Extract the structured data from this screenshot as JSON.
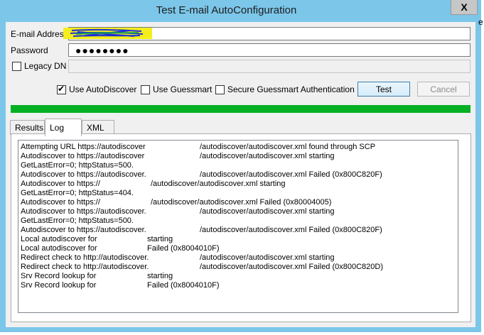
{
  "window": {
    "title": "Test E-mail AutoConfiguration",
    "close_glyph": "X",
    "side_char": "e"
  },
  "form": {
    "email_label": "E-mail Address",
    "password_label": "Password",
    "password_value": "●●●●●●●●",
    "legacy_dn_label": "Legacy DN"
  },
  "options": {
    "use_autodiscover": "Use AutoDiscover",
    "use_guessmart": "Use Guessmart",
    "secure_guessmart": "Secure Guessmart Authentication"
  },
  "buttons": {
    "test": "Test",
    "cancel": "Cancel"
  },
  "progress": {
    "percent": 100,
    "color": "#06b025"
  },
  "tabs": [
    "Results",
    "Log",
    "XML"
  ],
  "log": {
    "lines": [
      [
        "Attempting URL https://autodiscover",
        "/autodiscover/autodiscover.xml found through SCP"
      ],
      [
        "Autodiscover to https://autodiscover",
        "/autodiscover/autodiscover.xml starting"
      ],
      [
        "GetLastError=0; httpStatus=500.",
        ""
      ],
      [
        "Autodiscover to https://autodiscover.",
        "/autodiscover/autodiscover.xml Failed (0x800C820F)"
      ],
      [
        "Autodiscover to https://",
        "/autodiscover/autodiscover.xml starting"
      ],
      [
        "GetLastError=0; httpStatus=404.",
        ""
      ],
      [
        "Autodiscover to https://",
        "/autodiscover/autodiscover.xml Failed (0x80004005)"
      ],
      [
        "Autodiscover to https://autodiscover.",
        "/autodiscover/autodiscover.xml starting"
      ],
      [
        "GetLastError=0; httpStatus=500.",
        ""
      ],
      [
        "Autodiscover to https://autodiscover.",
        "/autodiscover/autodiscover.xml Failed (0x800C820F)"
      ],
      [
        "Local autodiscover for",
        "starting"
      ],
      [
        "Local autodiscover for",
        "Failed (0x8004010F)"
      ],
      [
        "Redirect check to http://autodiscover.",
        "/autodiscover/autodiscover.xml starting"
      ],
      [
        "Redirect check to http://autodiscover.",
        "/autodiscover/autodiscover.xml Failed (0x800C820D)"
      ],
      [
        "Srv Record lookup for",
        "starting"
      ],
      [
        "Srv Record lookup for",
        "Failed (0x8004010F)"
      ]
    ]
  }
}
